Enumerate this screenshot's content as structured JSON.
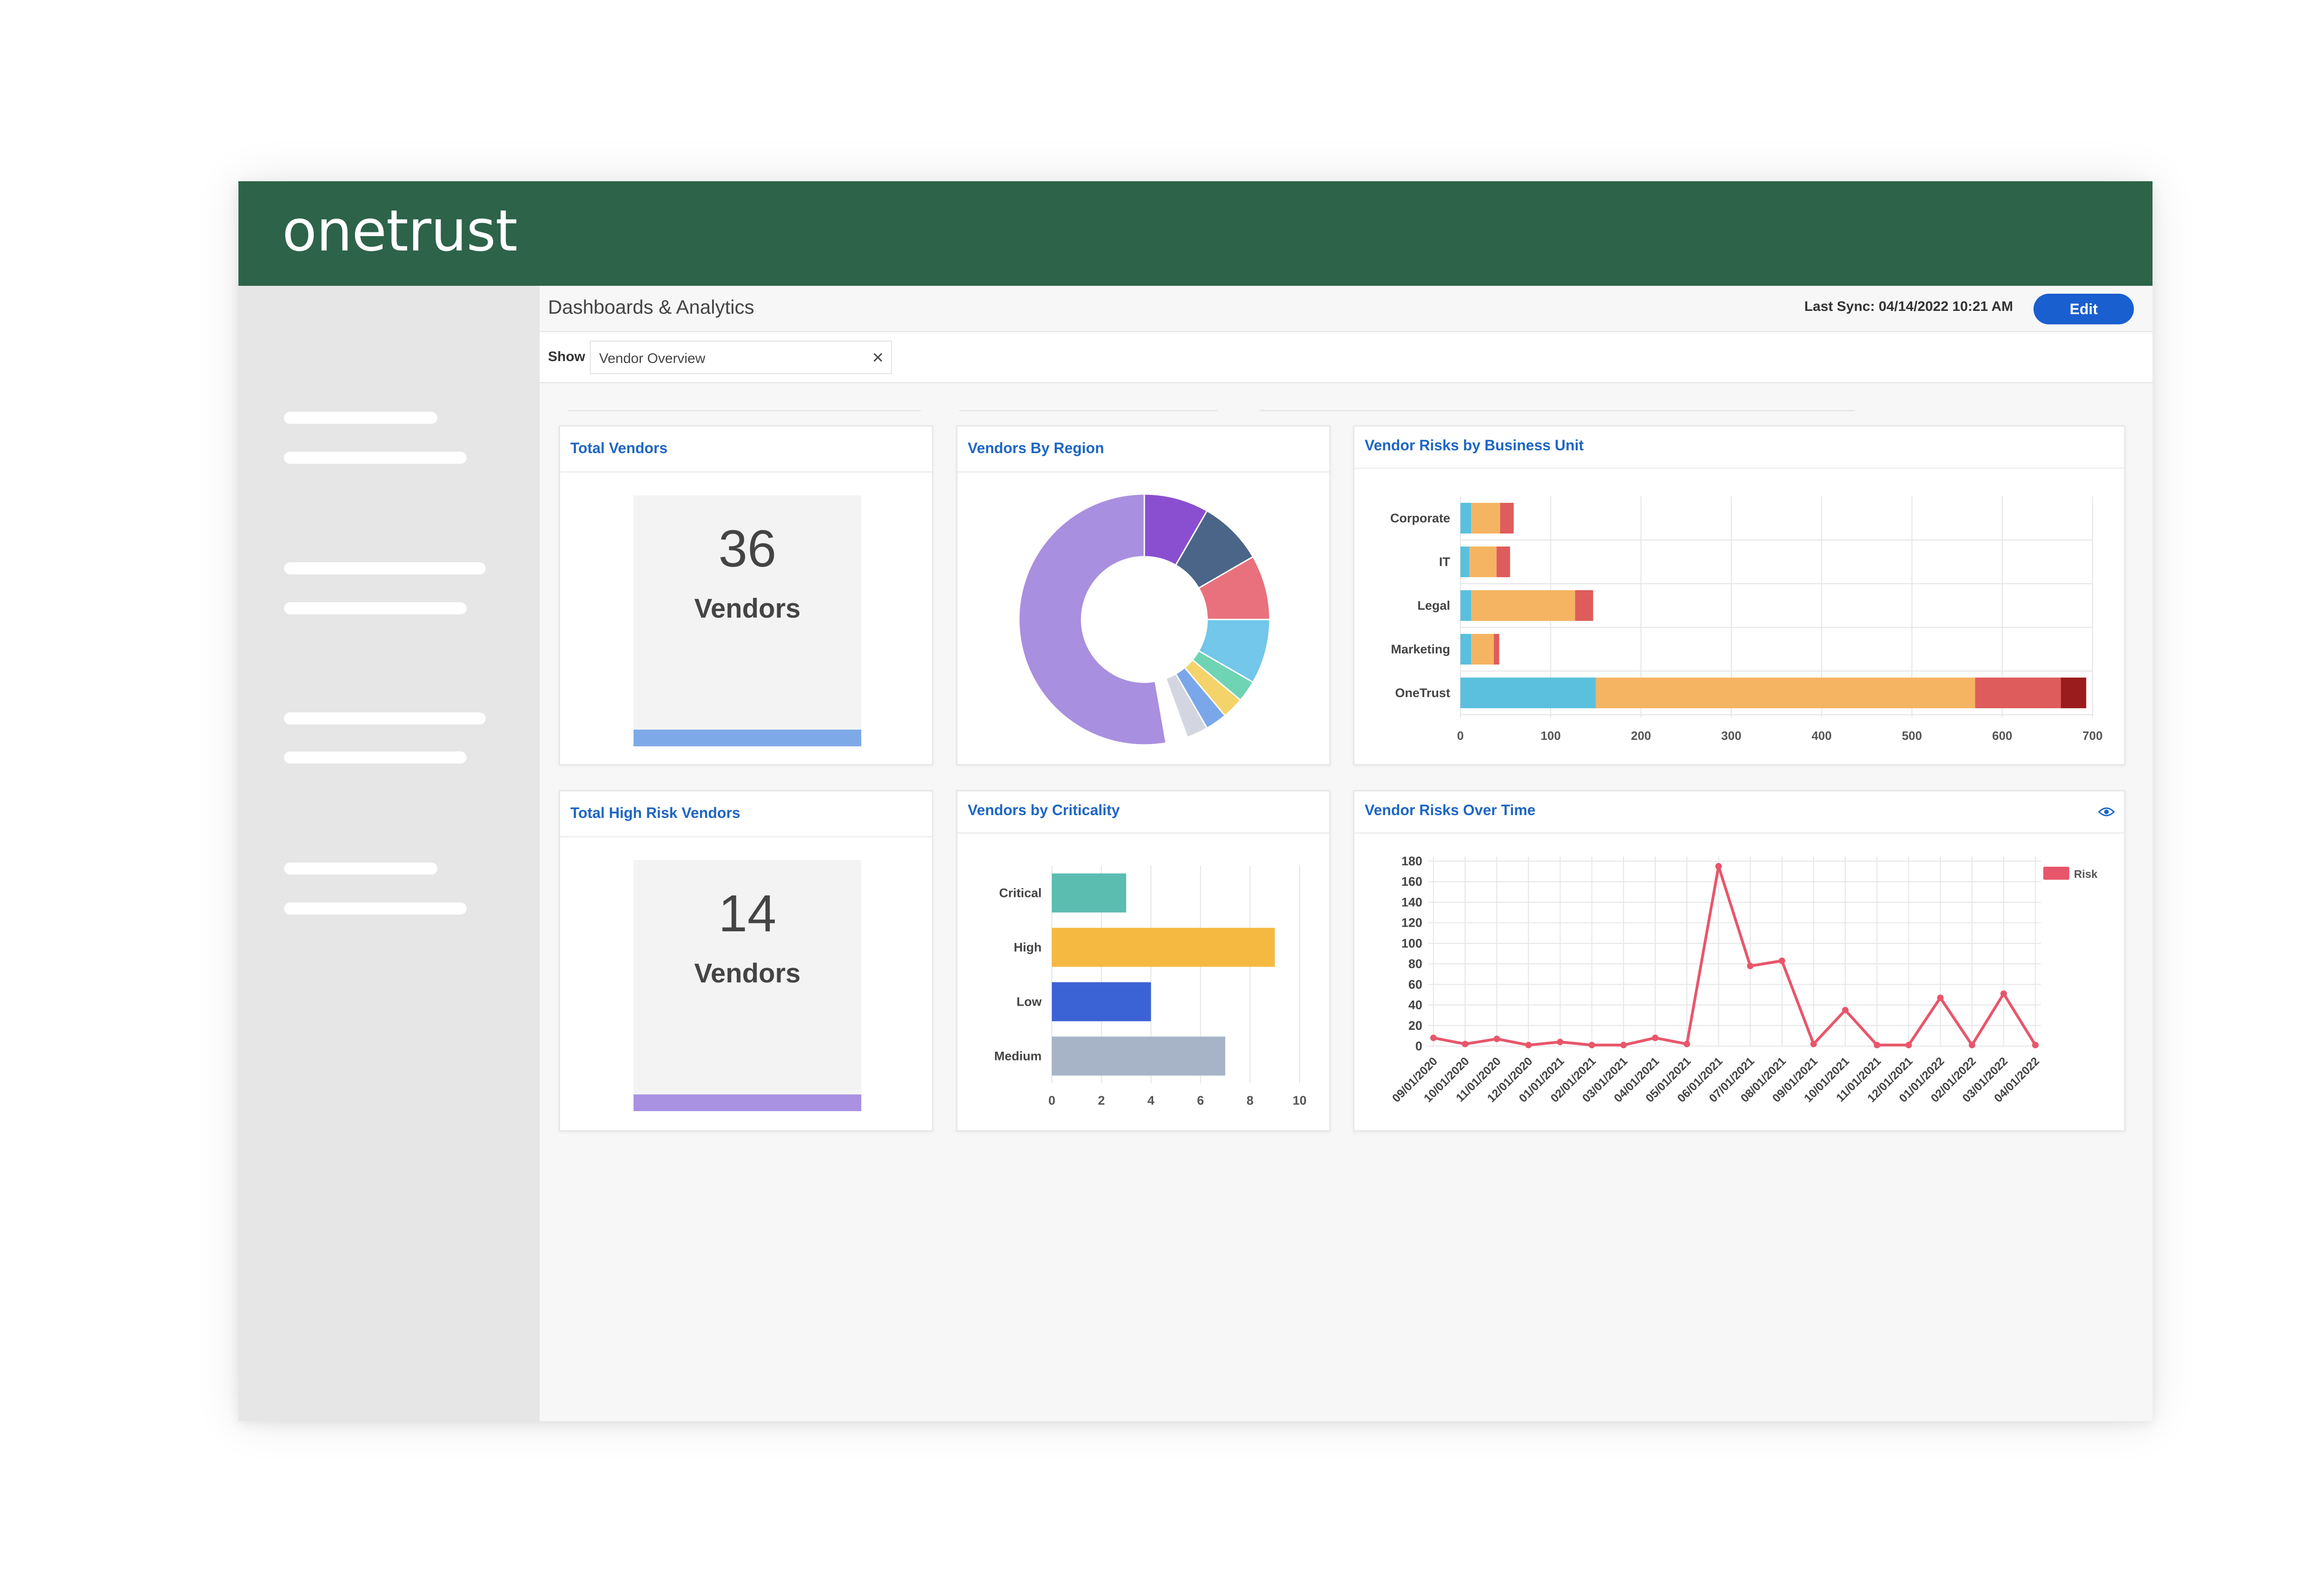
{
  "app": {
    "logo_text": "onetrust",
    "brand_color": "#2d6349"
  },
  "header": {
    "title": "Dashboards & Analytics",
    "last_sync": "Last Sync: 04/14/2022 10:21 AM",
    "edit_label": "Edit",
    "accent_color": "#1a5fd0"
  },
  "filter": {
    "label": "Show",
    "value": "Vendor Overview",
    "clear_icon": "close-icon"
  },
  "cards": {
    "total_vendors": {
      "title": "Total Vendors",
      "number": "36",
      "label": "Vendors",
      "bar_color": "#7ea9e8"
    },
    "high_risk": {
      "title": "Total High Risk Vendors",
      "number": "14",
      "label": "Vendors",
      "bar_color": "#a992e2"
    },
    "by_region": {
      "title": "Vendors By Region"
    },
    "risks_bu": {
      "title": "Vendor Risks by Business Unit"
    },
    "criticality": {
      "title": "Vendors by Criticality"
    },
    "over_time": {
      "title": "Vendor Risks Over Time",
      "icon": "eye-icon"
    }
  },
  "chart_data": [
    {
      "type": "pie",
      "title": "Vendors By Region",
      "donut": true,
      "values": [
        3,
        3,
        3,
        3,
        1,
        1,
        1,
        1,
        1,
        19
      ],
      "colors": [
        "#8a4fd0",
        "#4a6587",
        "#e8717d",
        "#72c7ea",
        "#6fd4b4",
        "#f5d36b",
        "#7aa7ea",
        "#d3d6e0",
        "#ffffff",
        "#a98fdf"
      ]
    },
    {
      "type": "bar",
      "orientation": "horizontal",
      "stacked": true,
      "title": "Vendor Risks by Business Unit",
      "categories": [
        "Corporate",
        "IT",
        "Legal",
        "Marketing",
        "OneTrust"
      ],
      "series": [
        {
          "values": [
            12,
            10,
            12,
            12,
            150
          ],
          "color": "#5bc0de"
        },
        {
          "values": [
            32,
            30,
            115,
            25,
            420
          ],
          "color": "#f5b461"
        },
        {
          "values": [
            15,
            15,
            20,
            6,
            95
          ],
          "color": "#df5c5c"
        },
        {
          "values": [
            0,
            0,
            0,
            0,
            28
          ],
          "color": "#9b1c1c"
        }
      ],
      "xlim": [
        0,
        700
      ],
      "xticks": [
        0,
        100,
        200,
        300,
        400,
        500,
        600,
        700
      ],
      "grid": true
    },
    {
      "type": "bar",
      "orientation": "horizontal",
      "title": "Vendors by Criticality",
      "categories": [
        "Critical",
        "High",
        "Low",
        "Medium"
      ],
      "values": [
        3,
        9,
        4,
        7
      ],
      "colors": [
        "#5bbcb0",
        "#f5b942",
        "#3c63d6",
        "#a7b4c8"
      ],
      "xlim": [
        0,
        10
      ],
      "xticks": [
        0,
        2,
        4,
        6,
        8,
        10
      ],
      "grid": true
    },
    {
      "type": "line",
      "title": "Vendor Risks Over Time",
      "x": [
        "09/01/2020",
        "10/01/2020",
        "11/01/2020",
        "12/01/2020",
        "01/01/2021",
        "02/01/2021",
        "03/01/2021",
        "04/01/2021",
        "05/01/2021",
        "06/01/2021",
        "07/01/2021",
        "08/01/2021",
        "09/01/2021",
        "10/01/2021",
        "11/01/2021",
        "12/01/2021",
        "01/01/2022",
        "02/01/2022",
        "03/01/2022",
        "04/01/2022"
      ],
      "series": [
        {
          "name": "Risk",
          "color": "#e8566b",
          "values": [
            8,
            2,
            7,
            1,
            4,
            1,
            1,
            8,
            2,
            175,
            78,
            83,
            2,
            35,
            1,
            1,
            47,
            1,
            51,
            1
          ]
        }
      ],
      "ylim": [
        0,
        180
      ],
      "yticks": [
        0,
        20,
        40,
        60,
        80,
        100,
        120,
        140,
        160,
        180
      ],
      "grid": true,
      "legend": "top-right"
    }
  ]
}
